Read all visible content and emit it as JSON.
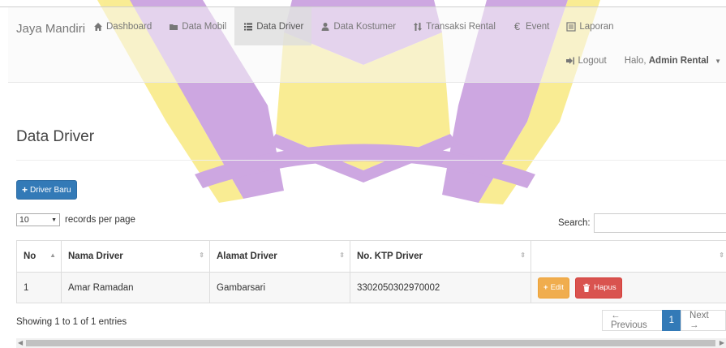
{
  "brand": "Jaya Mandiri",
  "nav": [
    {
      "label": "Dashboard",
      "icon": "home-icon",
      "active": false
    },
    {
      "label": "Data Mobil",
      "icon": "folder-icon",
      "active": false
    },
    {
      "label": "Data Driver",
      "icon": "list-icon",
      "active": true
    },
    {
      "label": "Data Kostumer",
      "icon": "user-icon",
      "active": false
    },
    {
      "label": "Transaksi Rental",
      "icon": "sort-icon",
      "active": false
    },
    {
      "label": "Event",
      "icon": "euro-icon",
      "active": false
    },
    {
      "label": "Laporan",
      "icon": "list-alt-icon",
      "active": false
    }
  ],
  "nav_right": {
    "logout": "Logout",
    "greeting": "Halo,",
    "username": "Admin Rental"
  },
  "page": {
    "title": "Data Driver",
    "new_button": "Driver Baru"
  },
  "table_controls": {
    "page_length": "10",
    "records_label": "records per page",
    "search_label": "Search:",
    "search_value": ""
  },
  "table": {
    "headers": [
      "No",
      "Nama Driver",
      "Alamat Driver",
      "No. KTP Driver",
      ""
    ],
    "rows": [
      {
        "no": "1",
        "nama": "Amar Ramadan",
        "alamat": "Gambarsari",
        "ktp": "3302050302970002",
        "edit": "Edit",
        "hapus": "Hapus"
      }
    ]
  },
  "footer": {
    "info": "Showing 1 to 1 of 1 entries",
    "prev": "← Previous",
    "current": "1",
    "next": "Next →"
  },
  "colors": {
    "primary": "#337ab7",
    "warning": "#f0ad4e",
    "danger": "#d9534f",
    "watermark_purple": "#7a1fa8",
    "watermark_yellow": "#f2d400"
  }
}
